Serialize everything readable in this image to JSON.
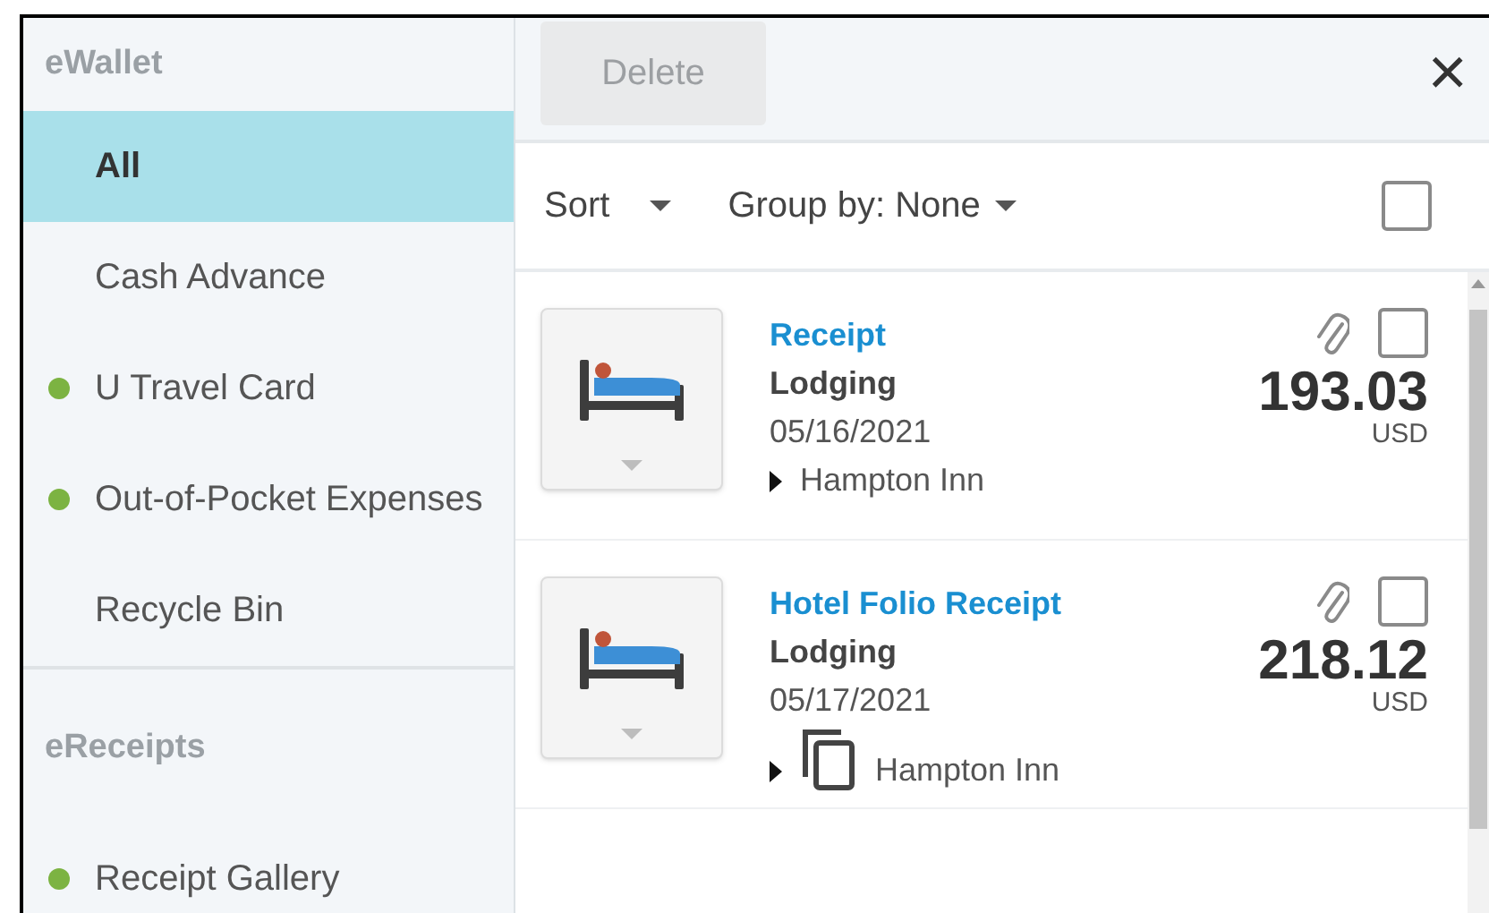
{
  "sidebar": {
    "sections": [
      {
        "title": "eWallet",
        "items": [
          {
            "label": "All",
            "selected": true
          },
          {
            "label": "Cash Advance",
            "selected": false
          },
          {
            "label": "U Travel Card",
            "selected": false,
            "color": "#7cb342"
          },
          {
            "label": "Out-of-Pocket Expenses",
            "selected": false,
            "color": "#7cb342"
          },
          {
            "label": "Recycle Bin",
            "selected": false
          }
        ]
      },
      {
        "title": "eReceipts",
        "items": [
          {
            "label": "Receipt Gallery",
            "selected": false,
            "color": "#7cb342"
          }
        ]
      }
    ]
  },
  "toolbar": {
    "delete": {
      "label": "Delete",
      "disabled": true
    },
    "close": "×"
  },
  "sortbar": {
    "sort": "Sort",
    "group_by": "Group by: None",
    "select_all": {
      "checked": false
    }
  },
  "expenses": [
    {
      "title": "Receipt",
      "category": "Lodging",
      "date": "05/16/2021",
      "vendor": "Hampton Inn",
      "amount": "193.03",
      "currency": "USD",
      "attachment": true,
      "copy": false,
      "checked": false
    },
    {
      "title": "Hotel Folio Receipt",
      "category": "Lodging",
      "date": "05/17/2021",
      "vendor": "Hampton Inn",
      "amount": "218.12",
      "currency": "USD",
      "attachment": true,
      "copy": true,
      "checked": false
    }
  ]
}
